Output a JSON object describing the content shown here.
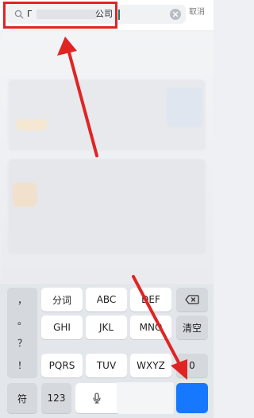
{
  "search": {
    "query_prefix": "Г",
    "query_suffix": "公司",
    "cancel_label": "取消"
  },
  "icons": {
    "search": "search-icon",
    "clear": "clear-icon",
    "backspace": "backspace-icon",
    "mic": "mic-icon"
  },
  "colors": {
    "annotation_red": "#e02424",
    "accent_blue": "#1677ff",
    "caret": "#1a7a66"
  },
  "keyboard": {
    "punct": [
      "，",
      "。",
      "？",
      "！"
    ],
    "rows": [
      [
        "分词",
        "ABC",
        "DEF"
      ],
      [
        "GHI",
        "JKL",
        "MNO"
      ],
      [
        "PQRS",
        "TUV",
        "WXYZ"
      ]
    ],
    "clear_label": "清空",
    "zero_label": "0",
    "symbol_label": "符",
    "num_label": "123"
  }
}
